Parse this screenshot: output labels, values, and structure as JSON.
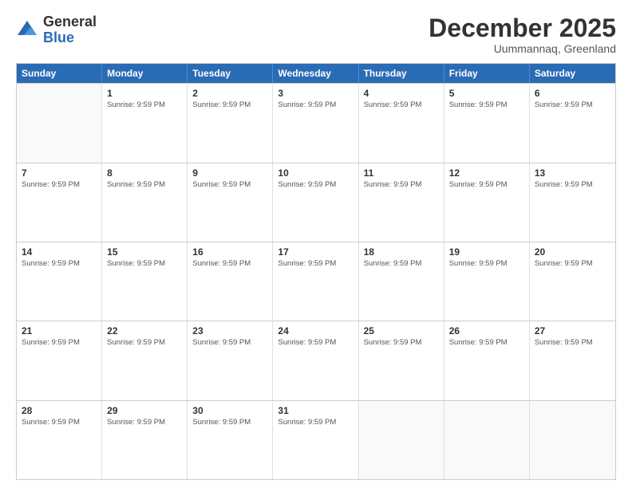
{
  "logo": {
    "general": "General",
    "blue": "Blue"
  },
  "title": {
    "month_year": "December 2025",
    "location": "Uummannaq, Greenland"
  },
  "calendar": {
    "headers": [
      "Sunday",
      "Monday",
      "Tuesday",
      "Wednesday",
      "Thursday",
      "Friday",
      "Saturday"
    ],
    "sunrise": "Sunrise: 9:59 PM",
    "weeks": [
      [
        {
          "day": "",
          "empty": true
        },
        {
          "day": "1"
        },
        {
          "day": "2"
        },
        {
          "day": "3"
        },
        {
          "day": "4"
        },
        {
          "day": "5"
        },
        {
          "day": "6"
        }
      ],
      [
        {
          "day": "7"
        },
        {
          "day": "8"
        },
        {
          "day": "9"
        },
        {
          "day": "10"
        },
        {
          "day": "11"
        },
        {
          "day": "12"
        },
        {
          "day": "13"
        }
      ],
      [
        {
          "day": "14"
        },
        {
          "day": "15"
        },
        {
          "day": "16"
        },
        {
          "day": "17"
        },
        {
          "day": "18"
        },
        {
          "day": "19"
        },
        {
          "day": "20"
        }
      ],
      [
        {
          "day": "21"
        },
        {
          "day": "22"
        },
        {
          "day": "23"
        },
        {
          "day": "24"
        },
        {
          "day": "25"
        },
        {
          "day": "26"
        },
        {
          "day": "27"
        }
      ],
      [
        {
          "day": "28"
        },
        {
          "day": "29"
        },
        {
          "day": "30"
        },
        {
          "day": "31"
        },
        {
          "day": "",
          "empty": true
        },
        {
          "day": "",
          "empty": true
        },
        {
          "day": "",
          "empty": true
        }
      ]
    ]
  }
}
